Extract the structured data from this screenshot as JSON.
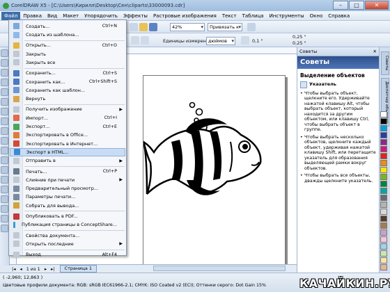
{
  "window": {
    "title": "CorelDRAW X5 - [C:\\Users\\Кирилл\\Desktop\\Сен\\cliparts\\33000093.cdr]"
  },
  "menubar": [
    "Файл",
    "Правка",
    "Вид",
    "Макет",
    "Упорядочить",
    "Эффекты",
    "Растровые изображения",
    "Текст",
    "Таблица",
    "Инструменты",
    "Окно",
    "Справка"
  ],
  "toolbar": {
    "zoom": "42%",
    "snap": "Привязать к",
    "units_label": "Единицы измерения:",
    "units": "дюймов",
    "nudge": "0,1 \"",
    "dup_x": "0,25 \"",
    "dup_y": "0,25 \""
  },
  "file_menu": [
    {
      "label": "Создать...",
      "shortcut": "Ctrl+N",
      "icon_color": "#7aa9de"
    },
    {
      "label": "Создать из шаблона...",
      "shortcut": "",
      "icon_color": "#8fb9e6"
    },
    {
      "label": "Открыть...",
      "shortcut": "Ctrl+O",
      "icon_color": "#e5b440"
    },
    {
      "label": "Закрыть",
      "shortcut": "",
      "icon_color": "#c0c8d4"
    },
    {
      "label": "Закрыть все",
      "shortcut": "",
      "icon_color": "#c0c8d4"
    },
    {
      "label": "Сохранить...",
      "shortcut": "Ctrl+S",
      "icon_color": "#4b79c2"
    },
    {
      "label": "Сохранить как...",
      "shortcut": "Ctrl+Shift+S",
      "icon_color": "#4b79c2"
    },
    {
      "label": "Сохранить как шаблон...",
      "shortcut": "",
      "icon_color": "#6d95d2"
    },
    {
      "label": "Вернуть",
      "shortcut": "",
      "icon_color": "#d9a44a"
    },
    {
      "label": "Получить изображение",
      "shortcut": "",
      "icon_color": "#c0c8d4",
      "submenu": true
    },
    {
      "label": "Импорт...",
      "shortcut": "Ctrl+I",
      "icon_color": "#e26a4a"
    },
    {
      "label": "Экспорт...",
      "shortcut": "Ctrl+E",
      "icon_color": "#4aa65a"
    },
    {
      "label": "Экспортировать в Office...",
      "shortcut": "",
      "icon_color": "#e07a3a"
    },
    {
      "label": "Экспортировать в Интернет...",
      "shortcut": "",
      "icon_color": "#d24a3a"
    },
    {
      "label": "Экспорт в HTML...",
      "shortcut": "",
      "icon_color": "#3a8ad2",
      "highlighted": true
    },
    {
      "label": "Отправить в",
      "shortcut": "",
      "icon_color": "#c0c8d4",
      "submenu": true
    },
    {
      "label": "Печать...",
      "shortcut": "Ctrl+P",
      "icon_color": "#6a7a8e"
    },
    {
      "label": "Слияние при печати",
      "shortcut": "",
      "icon_color": "#c0c8d4",
      "submenu": true
    },
    {
      "label": "Предварительный просмотр...",
      "shortcut": "",
      "icon_color": "#7a8aa0"
    },
    {
      "label": "Параметры печати...",
      "shortcut": "",
      "icon_color": "#7a8aa0"
    },
    {
      "label": "Собрать для вывода...",
      "shortcut": "",
      "icon_color": "#d2a23a"
    },
    {
      "label": "Опубликовать в PDF...",
      "shortcut": "",
      "icon_color": "#c23a3a"
    },
    {
      "label": "Публикация страницы в ConceptShare...",
      "shortcut": "",
      "icon_color": "#3a9ad2"
    },
    {
      "label": "Свойства документа...",
      "shortcut": "",
      "icon_color": "#c0c8d4"
    },
    {
      "label": "Открыть последние",
      "shortcut": "",
      "icon_color": "#c0c8d4",
      "submenu": true
    },
    {
      "label": "Выход",
      "shortcut": "Alt+F4",
      "icon_color": "#c0c8d4"
    }
  ],
  "docker": {
    "title": "Советы",
    "header": "Советы",
    "topic": "Выделение объектов",
    "tool": "Указатель",
    "tips": [
      "Чтобы выбрать объект, щелкните его. Удерживайте нажатой клавишу Alt, чтобы выбрать объект, который находится за другим объектом, или клавишу Ctrl, чтобы выбрать объект в группе.",
      "Чтобы выбрать несколько объектов, щелкните каждый объект, удерживая нажатой клавишу Shift, или перетащите указатель для образования выделяющей рамки вокруг объектов.",
      "Чтобы выбрать все объекты, дважды щелкните указатель."
    ],
    "side_tabs": [
      "Советы",
      "Диспетчер объектов"
    ]
  },
  "palette": [
    "#ffffff",
    "#000000",
    "#00a0e0",
    "#2d3e9b",
    "#8a2a8a",
    "#d21a7a",
    "#e2231a",
    "#f08a1a",
    "#ffe600",
    "#7ab51d",
    "#00843d",
    "#00a99d",
    "#6b6b6b",
    "#b3b3b3",
    "#d9d9d9",
    "#5c3a21",
    "#a67c52",
    "#c8a2c8",
    "#f7c6d9",
    "#9dd3f0",
    "#cde6b0",
    "#f9e7a0",
    "#e6b3a3"
  ],
  "page_nav": {
    "page_of": "1 из 1",
    "tab": "Страница 1"
  },
  "status": {
    "coords": "( -2,960; 12,863 )",
    "profile": "Цветовые профили документа: RGB: sRGB IEC61966-2.1; CMYK: ISO Coated v2 (ECI); Оттенки серого: Dot Gain 15%"
  },
  "watermark": "КАЧАЙКИН.РУ"
}
